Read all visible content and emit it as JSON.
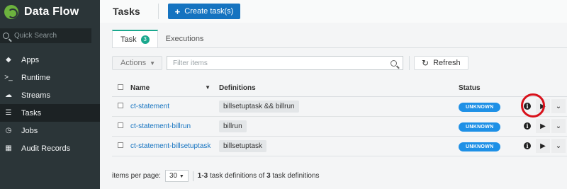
{
  "brand": {
    "title": "Data Flow"
  },
  "sidebar": {
    "search_placeholder": "Quick Search",
    "items": [
      {
        "label": "Apps",
        "icon": "tag-icon"
      },
      {
        "label": "Runtime",
        "icon": "terminal-icon"
      },
      {
        "label": "Streams",
        "icon": "cloud-icon"
      },
      {
        "label": "Tasks",
        "icon": "list-icon",
        "active": true
      },
      {
        "label": "Jobs",
        "icon": "clock-icon"
      },
      {
        "label": "Audit Records",
        "icon": "table-icon"
      }
    ]
  },
  "header": {
    "title": "Tasks",
    "create_button": "Create task(s)"
  },
  "tabs": [
    {
      "label": "Task",
      "badge": "3"
    },
    {
      "label": "Executions"
    }
  ],
  "toolbar": {
    "actions_label": "Actions",
    "filter_placeholder": "Filter items",
    "refresh_label": "Refresh"
  },
  "table": {
    "columns": [
      "Name",
      "Definitions",
      "Status"
    ],
    "rows": [
      {
        "name": "ct-statement",
        "definition": "billsetuptask && billrun",
        "status": "UNKNOWN"
      },
      {
        "name": "ct-statement-billrun",
        "definition": "billrun",
        "status": "UNKNOWN"
      },
      {
        "name": "ct-statement-billsetuptask",
        "definition": "billsetuptask",
        "status": "UNKNOWN"
      }
    ]
  },
  "pagination": {
    "items_per_page_label": "items per page:",
    "per_page": "30",
    "range": "1-3",
    "summary_mid": "task definitions of",
    "total": "3",
    "summary_end": "task definitions"
  },
  "colors": {
    "accent": "#1573c0",
    "status": "#1e90e6",
    "badge": "#1aa88e",
    "highlight": "#d8111b"
  }
}
